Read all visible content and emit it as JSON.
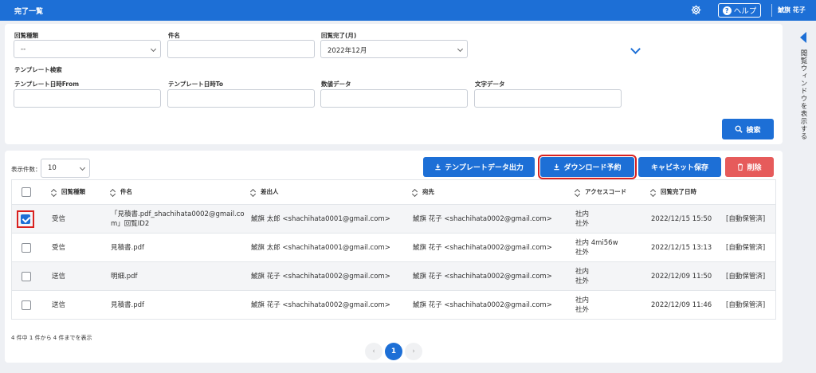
{
  "header": {
    "title": "完了一覧",
    "help_label": "ヘルプ",
    "help_q": "?",
    "user": "鯱旗 花子"
  },
  "side_panel": {
    "label": "閲覧ウィンドウを表示する"
  },
  "search": {
    "type_label": "回覧種類",
    "type_value": "--",
    "subject_label": "件名",
    "subject_value": "",
    "completed_label": "回覧完了(月)",
    "completed_value": "2022年12月",
    "template_search_label": "テンプレート検索",
    "tpl_from_label": "テンプレート日時From",
    "tpl_to_label": "テンプレート日時To",
    "number_label": "数値データ",
    "text_label": "文字データ",
    "search_button": "検索"
  },
  "list": {
    "count_label": "表示件数：",
    "count_value": "10",
    "buttons": {
      "template_export": "テンプレートデータ出力",
      "download_reserve": "ダウンロード予約",
      "cabinet_save": "キャビネット保存",
      "delete": "削除"
    },
    "columns": [
      "回覧種類",
      "件名",
      "差出人",
      "宛先",
      "アクセスコード",
      "回覧完了日時"
    ],
    "rows": [
      {
        "checked": true,
        "type": "受信",
        "subject": "「見積書.pdf_shachihata0002@gmail.com」回覧ID2",
        "sender": "鯱旗 太郎 <shachihata0001@gmail.com>",
        "to": "鯱旗 花子 <shachihata0002@gmail.com>",
        "access": "社内\n社外",
        "date": "2022/12/15 15:50",
        "status": "[自動保管済]"
      },
      {
        "checked": false,
        "type": "受信",
        "subject": "見積書.pdf",
        "sender": "鯱旗 太郎 <shachihata0001@gmail.com>",
        "to": "鯱旗 花子 <shachihata0002@gmail.com>",
        "access": "社内 4mi56w\n社外",
        "date": "2022/12/15 13:13",
        "status": "[自動保管済]"
      },
      {
        "checked": false,
        "type": "送信",
        "subject": "明細.pdf",
        "sender": "鯱旗 花子 <shachihata0002@gmail.com>",
        "to": "鯱旗 花子 <shachihata0002@gmail.com>",
        "access": "社内\n社外",
        "date": "2022/12/09 11:50",
        "status": "[自動保管済]"
      },
      {
        "checked": false,
        "type": "送信",
        "subject": "見積書.pdf",
        "sender": "鯱旗 花子 <shachihata0002@gmail.com>",
        "to": "鯱旗 花子 <shachihata0002@gmail.com>",
        "access": "社内\n社外",
        "date": "2022/12/09 11:46",
        "status": "[自動保管済]"
      }
    ],
    "summary": "4 件中 1 件から 4 件までを表示",
    "pagination": {
      "prev": "‹",
      "current": "1",
      "next": "›"
    }
  },
  "colors": {
    "primary": "#1d6fd6",
    "danger": "#e65b5b",
    "highlight": "#d9211f"
  }
}
